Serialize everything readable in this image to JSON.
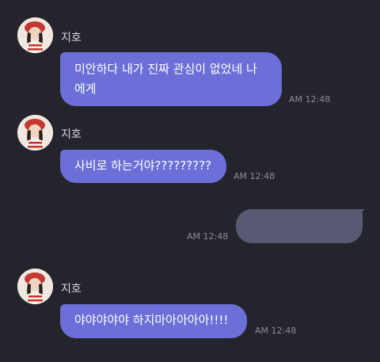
{
  "messages": [
    {
      "sender": "지호",
      "lines": [
        "미안하다 내가 진짜 관심이 없었네 나",
        "에게"
      ],
      "time": "AM 12:48"
    },
    {
      "sender": "지호",
      "lines": [
        "사비로 하는거야?????????"
      ],
      "time": "AM 12:48"
    },
    {
      "sender": "",
      "lines": [],
      "time": "AM 12:48",
      "redacted": true
    },
    {
      "sender": "지호",
      "lines": [
        "야야야야야 하지마아아아아!!!!"
      ],
      "time": "AM 12:48"
    }
  ],
  "colors": {
    "background": "#24242c",
    "incoming_bubble": "#6c6fd8",
    "outgoing_bubble": "#585a74",
    "timestamp": "#8c8c96"
  },
  "icons": {
    "avatar": "profile-photo-avatar"
  }
}
